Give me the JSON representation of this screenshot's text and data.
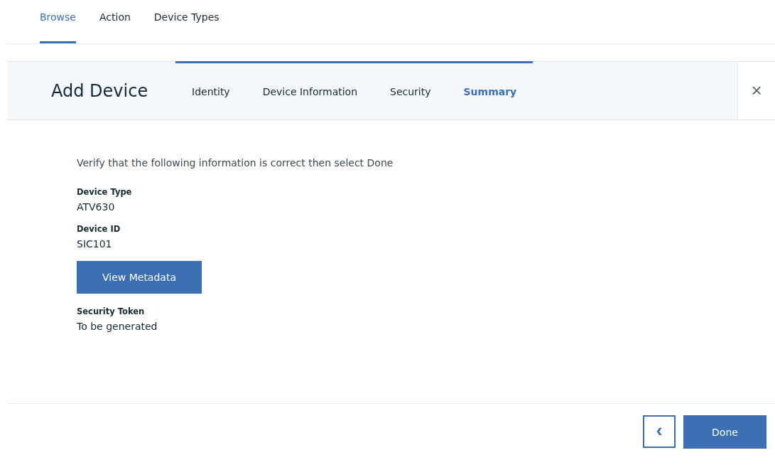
{
  "nav_tabs": [
    {
      "label": "Browse",
      "selected": true
    },
    {
      "label": "Action",
      "selected": false
    },
    {
      "label": "Device Types",
      "selected": false
    }
  ],
  "dialog": {
    "title": "Add Device",
    "steps": [
      {
        "label": "Identity",
        "completed": true,
        "selected": false
      },
      {
        "label": "Device Information",
        "completed": true,
        "selected": false
      },
      {
        "label": "Security",
        "completed": true,
        "selected": false
      },
      {
        "label": "Summary",
        "completed": true,
        "selected": true
      }
    ],
    "close": "×",
    "instruction": "Verify that the following information is correct then select Done",
    "fields": [
      {
        "kind": "value",
        "label": "Device Type",
        "value": "ATV630"
      },
      {
        "kind": "value",
        "label": "Device ID",
        "value": "SIC101"
      },
      {
        "kind": "button",
        "label": "View Metadata"
      },
      {
        "kind": "value",
        "label": "Security Token",
        "value": "To be generated"
      }
    ],
    "back": "‹",
    "done": "Done"
  }
}
